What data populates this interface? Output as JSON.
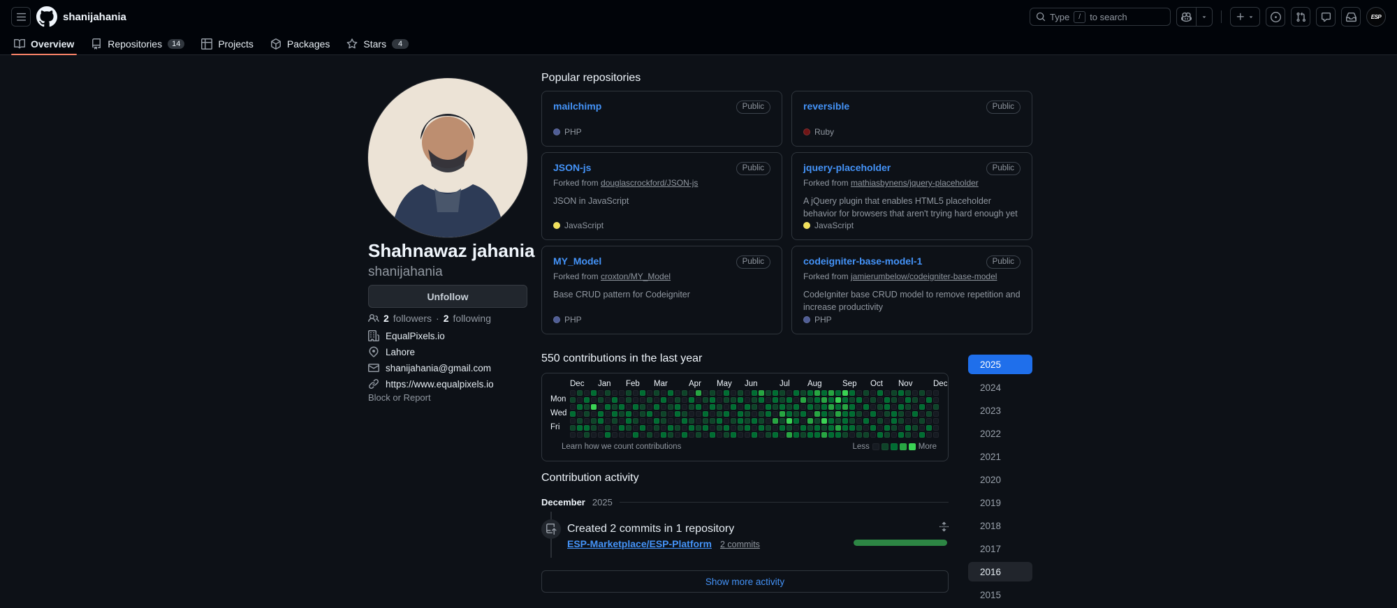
{
  "colors": {
    "page_bg": "#0d1117",
    "header_bg": "#010409",
    "accent_blue": "#4493f8",
    "tab_underline": "#f78166",
    "selected_year_bg": "#1f6feb",
    "activity_bar_green": "#2d8644",
    "contribution_levels": [
      "#161b22",
      "#0e4429",
      "#006d32",
      "#26a641",
      "#39d353"
    ]
  },
  "header": {
    "username": "shanijahania",
    "search_prefix": "Type",
    "search_key": "/",
    "search_suffix": "to search",
    "avatar_initials": "ESP"
  },
  "tabs": [
    {
      "label": "Overview",
      "icon": "book",
      "active": true
    },
    {
      "label": "Repositories",
      "icon": "repo",
      "count": "14"
    },
    {
      "label": "Projects",
      "icon": "project"
    },
    {
      "label": "Packages",
      "icon": "package"
    },
    {
      "label": "Stars",
      "icon": "star",
      "count": "4"
    }
  ],
  "profile": {
    "name": "Shahnawaz jahania",
    "login": "shanijahania",
    "follow_button": "Unfollow",
    "followers_count": "2",
    "followers_label": "followers",
    "separator": "·",
    "following_count": "2",
    "following_label": "following",
    "details": [
      {
        "icon": "organization",
        "text": "EqualPixels.io"
      },
      {
        "icon": "location",
        "text": "Lahore"
      },
      {
        "icon": "mail",
        "text": "shanijahania@gmail.com"
      },
      {
        "icon": "link",
        "text": "https://www.equalpixels.io"
      }
    ],
    "block_report": "Block or Report"
  },
  "popular": {
    "heading": "Popular repositories",
    "repos": [
      {
        "name": "mailchimp",
        "badge": "Public",
        "language": "PHP",
        "language_color": "#4F5D95"
      },
      {
        "name": "reversible",
        "badge": "Public",
        "language": "Ruby",
        "language_color": "#701516"
      },
      {
        "name": "JSON-js",
        "badge": "Public",
        "forked_prefix": "Forked from",
        "forked_from": "douglascrockford/JSON-js",
        "description": "JSON in JavaScript",
        "language": "JavaScript",
        "language_color": "#f1e05a"
      },
      {
        "name": "jquery-placeholder",
        "badge": "Public",
        "forked_prefix": "Forked from",
        "forked_from": "mathiasbynens/jquery-placeholder",
        "description": "A jQuery plugin that enables HTML5 placeholder behavior for browsers that aren't trying hard enough yet",
        "language": "JavaScript",
        "language_color": "#f1e05a"
      },
      {
        "name": "MY_Model",
        "badge": "Public",
        "forked_prefix": "Forked from",
        "forked_from": "croxton/MY_Model",
        "description": "Base CRUD pattern for Codeigniter",
        "language": "PHP",
        "language_color": "#4F5D95"
      },
      {
        "name": "codeigniter-base-model-1",
        "badge": "Public",
        "forked_prefix": "Forked from",
        "forked_from": "jamierumbelow/codeigniter-base-model",
        "description": "CodeIgniter base CRUD model to remove repetition and increase productivity",
        "language": "PHP",
        "language_color": "#4F5D95"
      }
    ]
  },
  "contributions": {
    "title": "550 contributions in the last year",
    "months": [
      {
        "label": "Dec",
        "week": 0
      },
      {
        "label": "Jan",
        "week": 4
      },
      {
        "label": "Feb",
        "week": 8
      },
      {
        "label": "Mar",
        "week": 12
      },
      {
        "label": "Apr",
        "week": 17
      },
      {
        "label": "May",
        "week": 21
      },
      {
        "label": "Jun",
        "week": 25
      },
      {
        "label": "Jul",
        "week": 30
      },
      {
        "label": "Aug",
        "week": 34
      },
      {
        "label": "Sep",
        "week": 39
      },
      {
        "label": "Oct",
        "week": 43
      },
      {
        "label": "Nov",
        "week": 47
      },
      {
        "label": "Dec",
        "week": 52
      }
    ],
    "day_labels": [
      {
        "label": "Mon",
        "row": 1
      },
      {
        "label": "Wed",
        "row": 3
      },
      {
        "label": "Fri",
        "row": 5
      }
    ],
    "footer_link": "Learn how we count contributions",
    "legend_less": "Less",
    "legend_more": "More",
    "weeks": [
      "0102010",
      "1020120",
      "0211021",
      "2040110",
      "0102200",
      "1020012",
      "0212100",
      "0021020",
      "1102210",
      "0020102",
      "2011020",
      "0102001",
      "1020210",
      "0201102",
      "2010021",
      "0122010",
      "1001202",
      "0210120",
      "3020011",
      "0102120",
      "1220102",
      "0011210",
      "2102021",
      "0120102",
      "1202210",
      "0021120",
      "2110202",
      "3201120",
      "1022011",
      "2210302",
      "1123120",
      "0212413",
      "2021202",
      "1302021",
      "2120312",
      "3213122",
      "2322413",
      "3231222",
      "2423132",
      "4232221",
      "2122120",
      "0201011",
      "1020201",
      "0102020",
      "2010102",
      "0221021",
      "1102210",
      "2021102",
      "1210021",
      "0102010",
      "1020102",
      "0201020",
      "0010000"
    ]
  },
  "years": [
    {
      "label": "2025",
      "selected": true
    },
    {
      "label": "2024"
    },
    {
      "label": "2023"
    },
    {
      "label": "2022"
    },
    {
      "label": "2021"
    },
    {
      "label": "2020"
    },
    {
      "label": "2019"
    },
    {
      "label": "2018"
    },
    {
      "label": "2017"
    },
    {
      "label": "2016",
      "hover": true
    },
    {
      "label": "2015"
    }
  ],
  "activity": {
    "heading": "Contribution activity",
    "period_month": "December",
    "period_year": "2025",
    "event_title": "Created 2 commits in 1 repository",
    "repo_link": "ESP-Marketplace/ESP-Platform",
    "commits_link": "2 commits",
    "show_more": "Show more activity"
  }
}
